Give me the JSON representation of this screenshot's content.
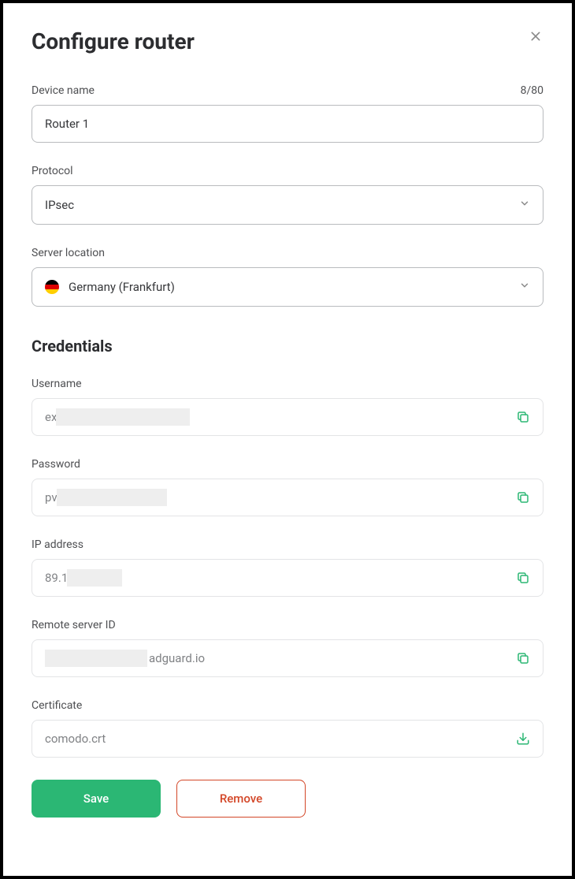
{
  "header": {
    "title": "Configure router"
  },
  "deviceName": {
    "label": "Device name",
    "value": "Router 1",
    "count": "8/80"
  },
  "protocol": {
    "label": "Protocol",
    "value": "IPsec"
  },
  "serverLocation": {
    "label": "Server location",
    "value": "Germany (Frankfurt)"
  },
  "credentialsTitle": "Credentials",
  "username": {
    "label": "Username",
    "prefix": "ex"
  },
  "password": {
    "label": "Password",
    "prefix": "pv"
  },
  "ipAddress": {
    "label": "IP address",
    "prefix": "89.1"
  },
  "remoteServerId": {
    "label": "Remote server ID",
    "suffix": "adguard.io"
  },
  "certificate": {
    "label": "Certificate",
    "value": "comodo.crt"
  },
  "buttons": {
    "save": "Save",
    "remove": "Remove"
  }
}
